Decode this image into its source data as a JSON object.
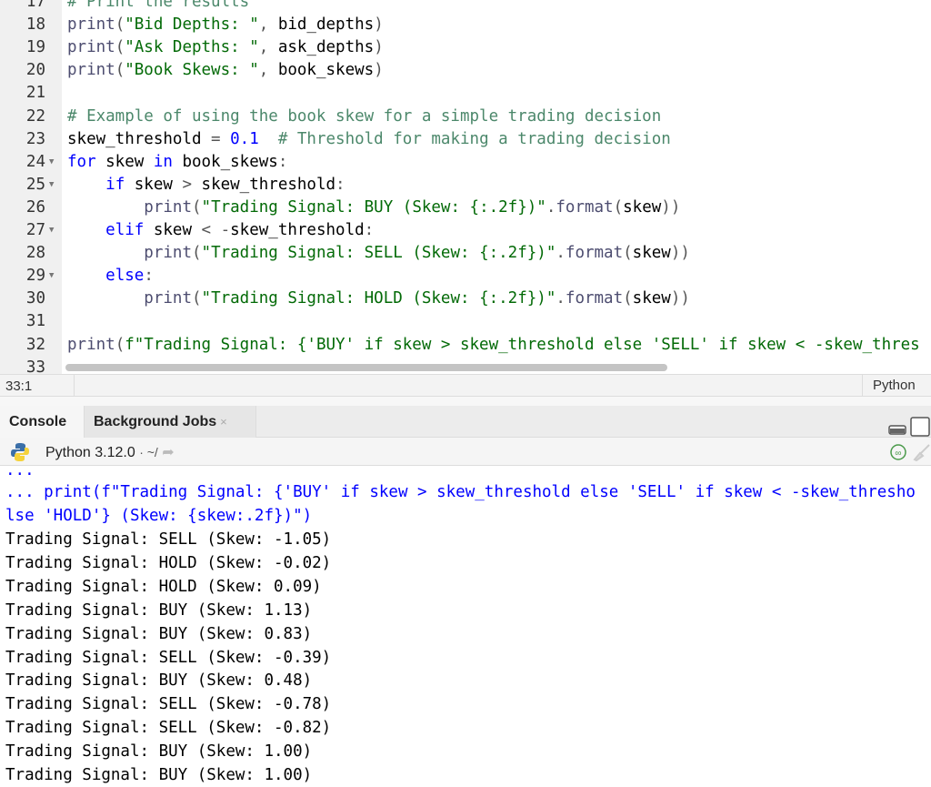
{
  "editor": {
    "lines": [
      {
        "n": "17",
        "fold": false,
        "tokens": [
          [
            "com",
            "# Print the results"
          ]
        ]
      },
      {
        "n": "18",
        "fold": false,
        "tokens": [
          [
            "fn",
            "print"
          ],
          [
            "p",
            "("
          ],
          [
            "str",
            "\"Bid Depths: \""
          ],
          [
            "p",
            ", "
          ],
          [
            "id",
            "bid_depths"
          ],
          [
            "p",
            ")"
          ]
        ]
      },
      {
        "n": "19",
        "fold": false,
        "tokens": [
          [
            "fn",
            "print"
          ],
          [
            "p",
            "("
          ],
          [
            "str",
            "\"Ask Depths: \""
          ],
          [
            "p",
            ", "
          ],
          [
            "id",
            "ask_depths"
          ],
          [
            "p",
            ")"
          ]
        ]
      },
      {
        "n": "20",
        "fold": false,
        "tokens": [
          [
            "fn",
            "print"
          ],
          [
            "p",
            "("
          ],
          [
            "str",
            "\"Book Skews: \""
          ],
          [
            "p",
            ", "
          ],
          [
            "id",
            "book_skews"
          ],
          [
            "p",
            ")"
          ]
        ]
      },
      {
        "n": "21",
        "fold": false,
        "tokens": []
      },
      {
        "n": "22",
        "fold": false,
        "tokens": [
          [
            "com",
            "# Example of using the book skew for a simple trading decision"
          ]
        ]
      },
      {
        "n": "23",
        "fold": false,
        "tokens": [
          [
            "id",
            "skew_threshold "
          ],
          [
            "p",
            "= "
          ],
          [
            "num",
            "0.1"
          ],
          [
            "id",
            "  "
          ],
          [
            "com",
            "# Threshold for making a trading decision"
          ]
        ]
      },
      {
        "n": "24",
        "fold": true,
        "tokens": [
          [
            "kw",
            "for"
          ],
          [
            "id",
            " skew "
          ],
          [
            "kw",
            "in"
          ],
          [
            "id",
            " book_skews"
          ],
          [
            "p",
            ":"
          ]
        ]
      },
      {
        "n": "25",
        "fold": true,
        "tokens": [
          [
            "id",
            "    "
          ],
          [
            "kw",
            "if"
          ],
          [
            "id",
            " skew "
          ],
          [
            "p",
            "> "
          ],
          [
            "id",
            "skew_threshold"
          ],
          [
            "p",
            ":"
          ]
        ]
      },
      {
        "n": "26",
        "fold": false,
        "tokens": [
          [
            "id",
            "        "
          ],
          [
            "fn",
            "print"
          ],
          [
            "p",
            "("
          ],
          [
            "str",
            "\"Trading Signal: BUY (Skew: {:.2f})\""
          ],
          [
            "p",
            "."
          ],
          [
            "fn",
            "format"
          ],
          [
            "p",
            "("
          ],
          [
            "id",
            "skew"
          ],
          [
            "p",
            "))"
          ]
        ]
      },
      {
        "n": "27",
        "fold": true,
        "tokens": [
          [
            "id",
            "    "
          ],
          [
            "kw",
            "elif"
          ],
          [
            "id",
            " skew "
          ],
          [
            "p",
            "< -"
          ],
          [
            "id",
            "skew_threshold"
          ],
          [
            "p",
            ":"
          ]
        ]
      },
      {
        "n": "28",
        "fold": false,
        "tokens": [
          [
            "id",
            "        "
          ],
          [
            "fn",
            "print"
          ],
          [
            "p",
            "("
          ],
          [
            "str",
            "\"Trading Signal: SELL (Skew: {:.2f})\""
          ],
          [
            "p",
            "."
          ],
          [
            "fn",
            "format"
          ],
          [
            "p",
            "("
          ],
          [
            "id",
            "skew"
          ],
          [
            "p",
            "))"
          ]
        ]
      },
      {
        "n": "29",
        "fold": true,
        "tokens": [
          [
            "id",
            "    "
          ],
          [
            "kw",
            "else"
          ],
          [
            "p",
            ":"
          ]
        ]
      },
      {
        "n": "30",
        "fold": false,
        "tokens": [
          [
            "id",
            "        "
          ],
          [
            "fn",
            "print"
          ],
          [
            "p",
            "("
          ],
          [
            "str",
            "\"Trading Signal: HOLD (Skew: {:.2f})\""
          ],
          [
            "p",
            "."
          ],
          [
            "fn",
            "format"
          ],
          [
            "p",
            "("
          ],
          [
            "id",
            "skew"
          ],
          [
            "p",
            "))"
          ]
        ]
      },
      {
        "n": "31",
        "fold": false,
        "tokens": []
      },
      {
        "n": "32",
        "fold": false,
        "tokens": [
          [
            "fn",
            "print"
          ],
          [
            "p",
            "("
          ],
          [
            "str",
            "f\"Trading Signal: {'BUY' if skew > skew_threshold else 'SELL' if skew < -skew_thres"
          ]
        ]
      },
      {
        "n": "33",
        "fold": false,
        "tokens": []
      }
    ]
  },
  "status": {
    "position": "33:1",
    "language": "Python"
  },
  "console": {
    "tabs": [
      {
        "label": "Console"
      },
      {
        "label": "Background Jobs",
        "close": "×"
      }
    ],
    "python_version": "Python 3.12.0",
    "path": "· ~/",
    "input_lines": [
      "...",
      "... print(f\"Trading Signal: {'BUY' if skew > skew_threshold else 'SELL' if skew < -skew_thresho",
      "lse 'HOLD'} (Skew: {skew:.2f})\")"
    ],
    "output_lines": [
      "Trading Signal: SELL (Skew: -1.05)",
      "Trading Signal: HOLD (Skew: -0.02)",
      "Trading Signal: HOLD (Skew: 0.09)",
      "Trading Signal: BUY (Skew: 1.13)",
      "Trading Signal: BUY (Skew: 0.83)",
      "Trading Signal: SELL (Skew: -0.39)",
      "Trading Signal: BUY (Skew: 0.48)",
      "Trading Signal: SELL (Skew: -0.78)",
      "Trading Signal: SELL (Skew: -0.82)",
      "Trading Signal: BUY (Skew: 1.00)",
      "Trading Signal: BUY (Skew: 1.00)"
    ]
  }
}
